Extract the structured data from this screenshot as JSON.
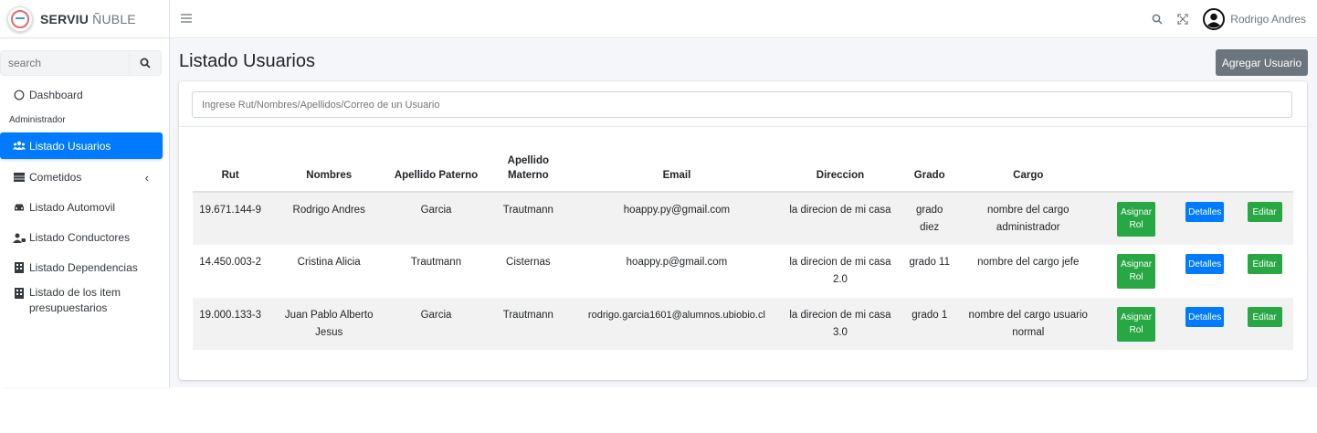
{
  "brand": {
    "bold": "SERVIU",
    "light": " ÑUBLE"
  },
  "sidebar": {
    "search_placeholder": "search",
    "items": [
      {
        "label": "Dashboard",
        "icon": "circle-icon"
      },
      {
        "header": "Administrador"
      },
      {
        "label": "Listado Usuarios",
        "icon": "users-icon",
        "active": true
      },
      {
        "label": "Cometidos",
        "icon": "table-icon",
        "chevron": "‹"
      },
      {
        "label": "Listado Automovil",
        "icon": "car-icon"
      },
      {
        "label": "Listado Conductores",
        "icon": "user-tie-icon"
      },
      {
        "label": "Listado Dependencias",
        "icon": "building-icon"
      },
      {
        "label": "Listado de los item presupuestarios",
        "icon": "building-icon"
      }
    ]
  },
  "topbar": {
    "user_name": "Rodrigo Andres"
  },
  "page": {
    "title": "Listado Usuarios",
    "add_button": "Agregar Usuario",
    "filter_placeholder": "Ingrese Rut/Nombres/Apellidos/Correo de un Usuario"
  },
  "table": {
    "columns": [
      "Rut",
      "Nombres",
      "Apellido Paterno",
      "Apellido Materno",
      "Email",
      "Direccion",
      "Grado",
      "Cargo"
    ],
    "action_labels": {
      "asignar": "Asignar Rol",
      "detalles": "Detalles",
      "editar": "Editar"
    },
    "rows": [
      {
        "rut": "19.671.144-9",
        "nombres": "Rodrigo Andres",
        "paterno": "Garcia",
        "materno": "Trautmann",
        "email": "hoappy.py@gmail.com",
        "direccion": "la direcion de mi casa",
        "grado": "grado diez",
        "cargo": "nombre del cargo administrador"
      },
      {
        "rut": "14.450.003-2",
        "nombres": "Cristina Alicia",
        "paterno": "Trautmann",
        "materno": "Cisternas",
        "email": "hoappy.p@gmail.com",
        "direccion": "la direcion de mi casa 2.0",
        "grado": "grado 11",
        "cargo": "nombre del cargo jefe"
      },
      {
        "rut": "19.000.133-3",
        "nombres": "Juan Pablo Alberto Jesus",
        "paterno": "Garcia",
        "materno": "Trautmann",
        "email": "rodrigo.garcia1601@alumnos.ubiobio.cl",
        "direccion": "la direcion de mi casa 3.0",
        "grado": "grado 1",
        "cargo": "nombre del cargo usuario normal"
      }
    ]
  },
  "colors": {
    "primary": "#007bff",
    "success": "#28a745",
    "secondary": "#6c757d",
    "content_bg": "#f4f6f9"
  }
}
